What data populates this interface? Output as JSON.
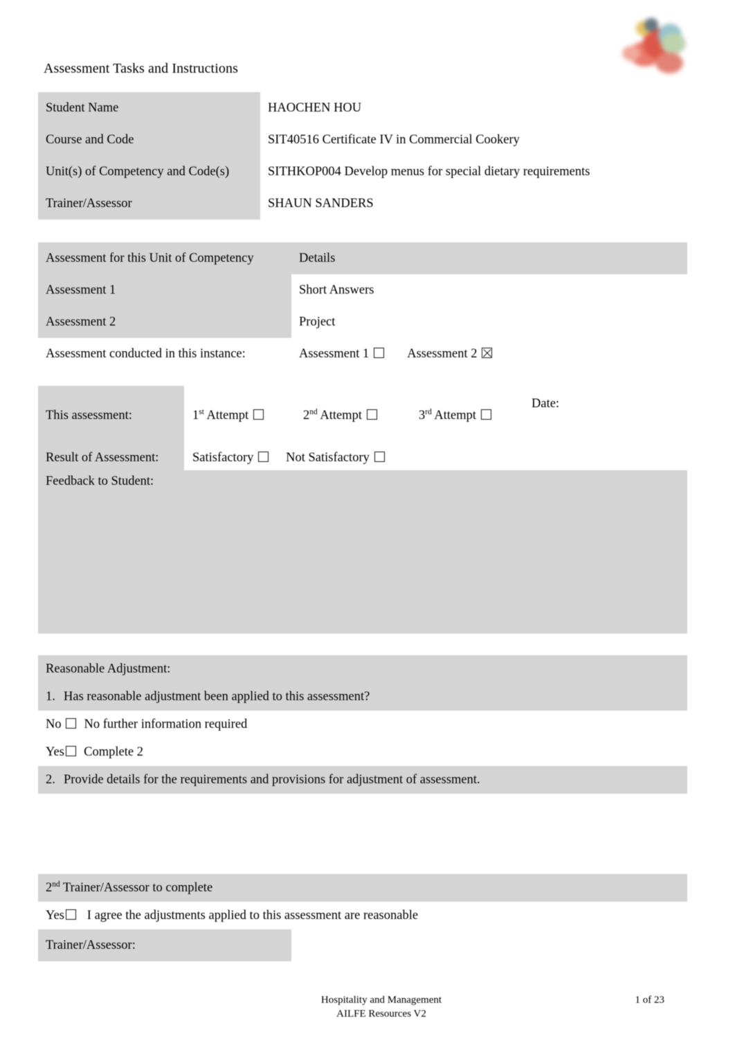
{
  "document": {
    "title": "Assessment Tasks and Instructions",
    "logo_icon": "organisation-logo-icon"
  },
  "student_info": {
    "rows": [
      {
        "label": "Student Name",
        "value": "HAOCHEN HOU"
      },
      {
        "label": "Course and Code",
        "value": "SIT40516 Certificate IV in Commercial Cookery"
      },
      {
        "label": "Unit(s) of Competency and Code(s)",
        "value": "SITHKOP004 Develop menus for special dietary requirements"
      },
      {
        "label": "Trainer/Assessor",
        "value": "SHAUN SANDERS"
      }
    ]
  },
  "assessment_details": {
    "header_label": "Assessment for this Unit of Competency",
    "header_details": "Details",
    "rows": [
      {
        "label": "Assessment 1",
        "value": "Short Answers"
      },
      {
        "label": "Assessment 2",
        "value": "Project"
      }
    ],
    "conducted_label": "Assessment conducted in this instance:",
    "option_1_label": "Assessment 1",
    "option_1_checked": false,
    "option_2_label": "Assessment 2",
    "option_2_checked": true
  },
  "result_block": {
    "this_assessment_label": "This assessment:",
    "attempt_1_prefix": "1",
    "attempt_1_sup": "st",
    "attempt_1_label": "Attempt",
    "attempt_1_checked": false,
    "attempt_2_prefix": "2",
    "attempt_2_sup": "nd",
    "attempt_2_label": "Attempt",
    "attempt_2_checked": false,
    "attempt_3_prefix": "3",
    "attempt_3_sup": "rd",
    "attempt_3_label": "Attempt",
    "attempt_3_checked": false,
    "date_label": "Date:",
    "date_value": "",
    "result_label": "Result of Assessment:",
    "satisfactory_label": "Satisfactory",
    "satisfactory_checked": false,
    "not_satisfactory_label": "Not Satisfactory",
    "not_satisfactory_checked": false,
    "feedback_label": "Feedback to Student:",
    "feedback_value": ""
  },
  "reasonable_adjustment": {
    "heading": "Reasonable Adjustment:",
    "q1_number": "1.",
    "q1_text": "Has reasonable adjustment been applied to this assessment?",
    "no_label": "No",
    "no_checked": false,
    "no_note": "No further information required",
    "yes_label": "Yes",
    "yes_checked": false,
    "yes_note": "Complete 2",
    "q2_number": "2.",
    "q2_text": "Provide details for the requirements and provisions for adjustment of assessment.",
    "q2_value": "",
    "second_assessor_prefix": "2",
    "second_assessor_sup": "nd",
    "second_assessor_label": "Trainer/Assessor to complete",
    "agree_yes_label": "Yes",
    "agree_yes_checked": false,
    "agree_text": "I agree the adjustments applied to this assessment are reasonable",
    "trainer_label": "Trainer/Assessor:",
    "trainer_value": ""
  },
  "footer": {
    "line1": "Hospitality and Management",
    "line2": "AILFE Resources V2",
    "page_number": "1 of 23"
  }
}
